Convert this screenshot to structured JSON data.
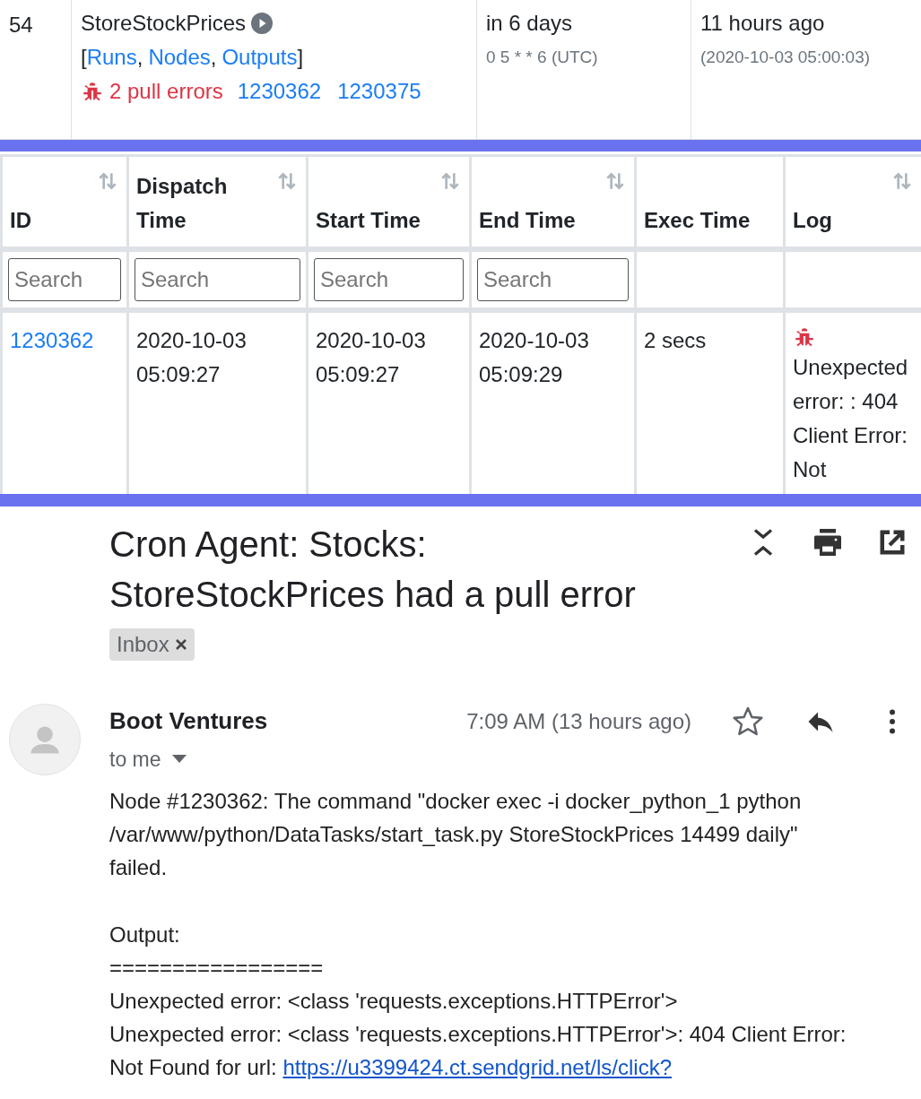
{
  "job": {
    "id": "54",
    "name": "StoreStockPrices",
    "links": [
      "Runs",
      "Nodes",
      "Outputs"
    ],
    "link_open": "[",
    "link_separator": ",",
    "link_close": "]",
    "errors": "2 pull errors",
    "error_nodes": [
      "1230362",
      "1230375"
    ],
    "next_run": "in 6 days",
    "schedule": "0 5 * * 6 (UTC)",
    "last_run": "11 hours ago",
    "last_run_time": "(2020-10-03 05:00:03)"
  },
  "runs_table": {
    "columns": [
      {
        "label": "ID",
        "sortable": true,
        "placeholder": "Search"
      },
      {
        "label": "Dispatch Time",
        "sortable": true,
        "placeholder": "Search"
      },
      {
        "label": "Start Time",
        "sortable": true,
        "placeholder": "Search"
      },
      {
        "label": "End Time",
        "sortable": true,
        "placeholder": "Search"
      },
      {
        "label": "Exec Time",
        "sortable": false
      },
      {
        "label": "Log",
        "sortable": true
      }
    ],
    "rows": [
      {
        "id": "1230362",
        "dispatch": "2020-10-03 05:09:27",
        "start": "2020-10-03 05:09:27",
        "end": "2020-10-03 05:09:29",
        "exec": "2 secs",
        "error": true,
        "log": "Unexpected error: : 404 Client Error: Not"
      }
    ]
  },
  "email": {
    "subject": "Cron Agent: Stocks: StoreStockPrices had a pull error",
    "labels": [
      "Inbox"
    ],
    "sender": "Boot Ventures",
    "recipient": "to me",
    "time": "7:09 AM (13 hours ago)",
    "starred": false,
    "body": [
      {
        "text": "Node #1230362: The command \"docker exec -i docker_python_1 python /var/www/python/DataTasks/start_task.py StoreStockPrices 14499 daily\" failed."
      },
      {
        "text": "Output:"
      },
      {
        "text": "================="
      },
      {
        "text": "Unexpected error: <class 'requests.exceptions.HTTPError'>"
      },
      {
        "text": "Unexpected error: <class 'requests.exceptions.HTTPError'>: 404 Client Error: Not Found for url:",
        "link": "https://u3399424.ct.sendgrid.net/ls/click?"
      }
    ]
  }
}
